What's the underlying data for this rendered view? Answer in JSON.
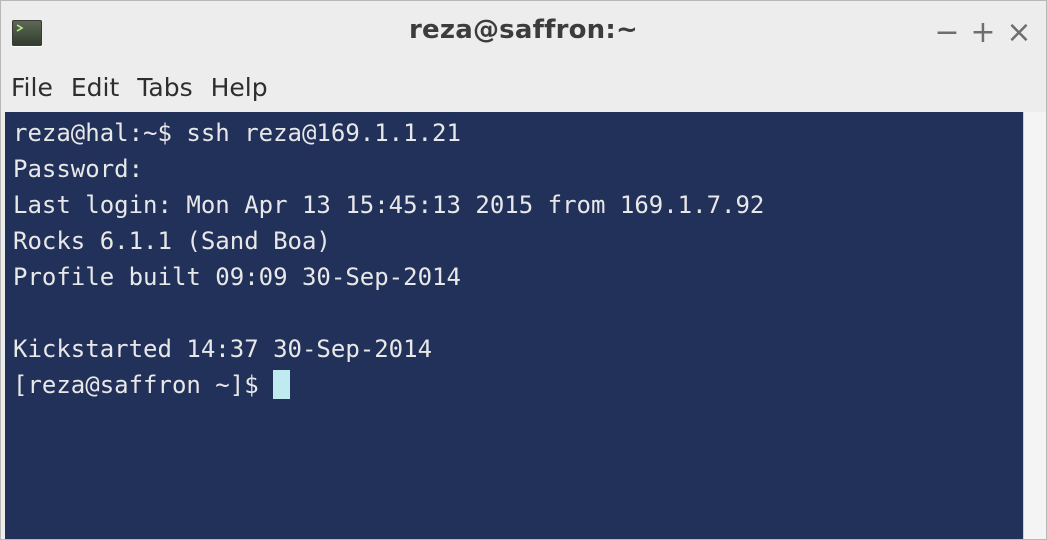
{
  "window": {
    "title": "reza@saffron:~",
    "controls": {
      "minimize": "−",
      "maximize": "+",
      "close": "×"
    }
  },
  "menubar": {
    "items": [
      "File",
      "Edit",
      "Tabs",
      "Help"
    ]
  },
  "terminal": {
    "background_color": "#223159",
    "cursor_color": "#bfeaf0",
    "lines": [
      "reza@hal:~$ ssh reza@169.1.1.21",
      "Password:",
      "Last login: Mon Apr 13 15:45:13 2015 from 169.1.7.92",
      "Rocks 6.1.1 (Sand Boa)",
      "Profile built 09:09 30-Sep-2014",
      "",
      "Kickstarted 14:37 30-Sep-2014",
      "[reza@saffron ~]$ "
    ]
  },
  "icons": {
    "app": "terminal-icon"
  }
}
